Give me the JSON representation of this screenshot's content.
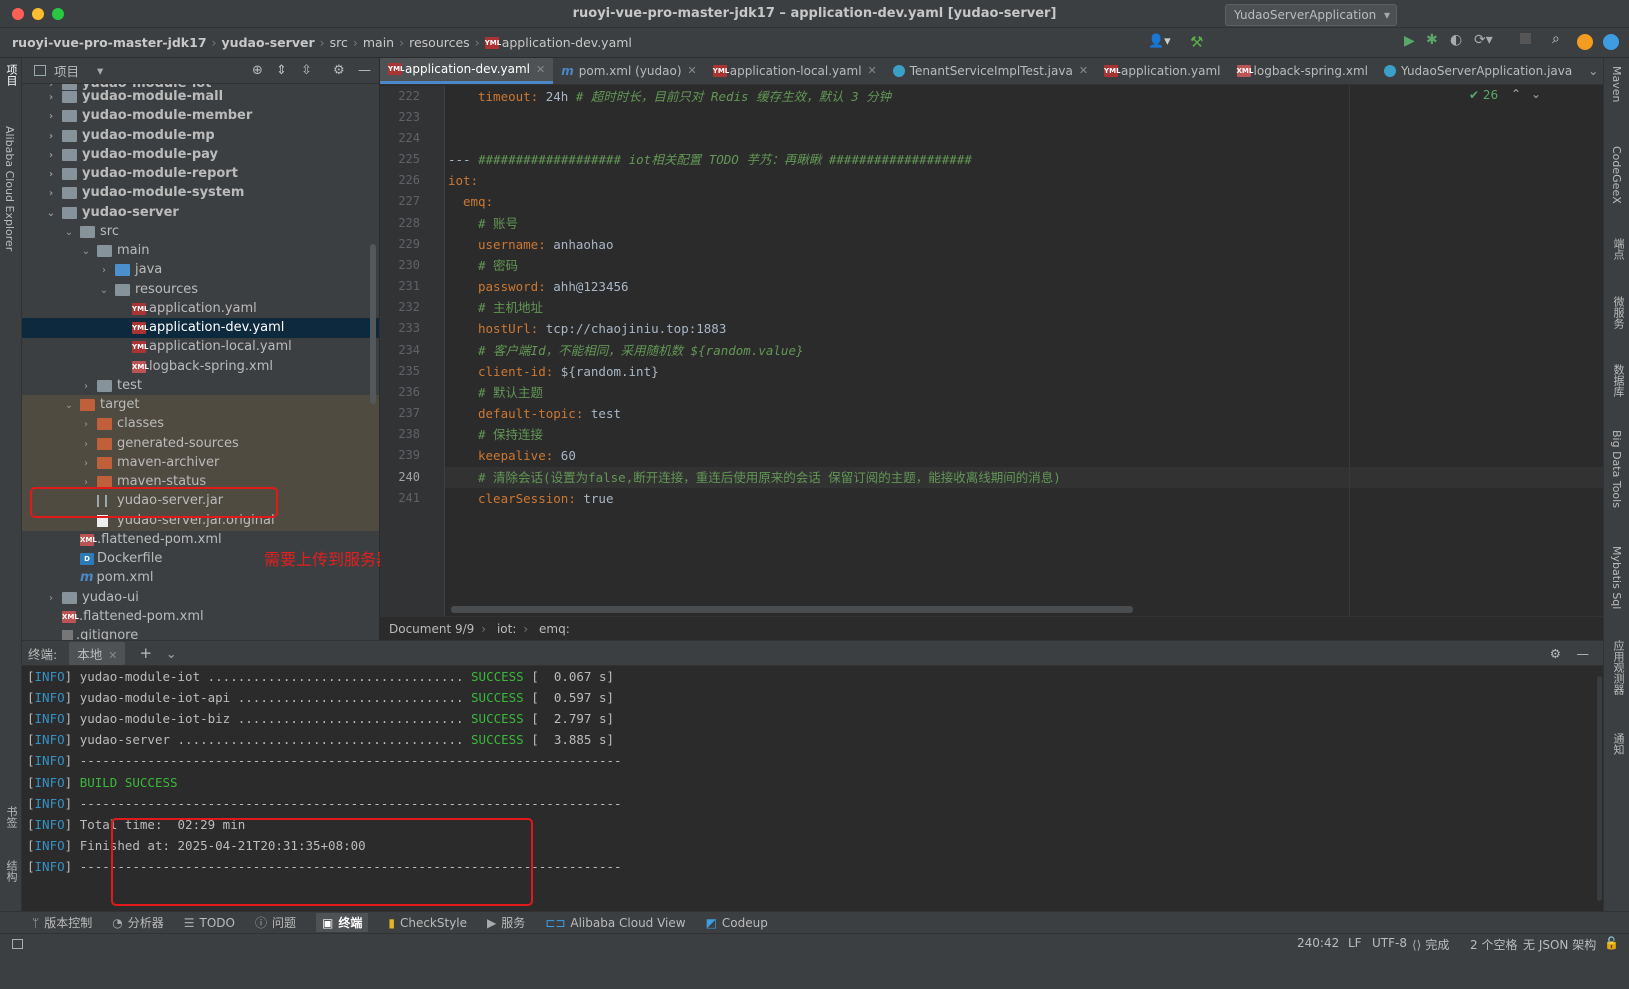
{
  "window": {
    "title": "ruoyi-vue-pro-master-jdk17 – application-dev.yaml [yudao-server]"
  },
  "breadcrumb": [
    "ruoyi-vue-pro-master-jdk17",
    "yudao-server",
    "src",
    "main",
    "resources",
    "application-dev.yaml"
  ],
  "run_config": "YudaoServerApplication",
  "project_panel": {
    "title": "项目"
  },
  "left_strip": {
    "project": "项目",
    "alibaba": "Alibaba Cloud Explorer",
    "bookmarks": "书签",
    "structure": "结构"
  },
  "right_strip": {
    "maven": "Maven",
    "codegeex": "CodeGeeX",
    "endpoints": "端点",
    "microservice": "微服务",
    "database": "数据库",
    "bigdata": "Big Data Tools",
    "mybatis": "Mybatis Sql",
    "appmonitor": "应用观测器",
    "notify": "通知"
  },
  "tree": [
    {
      "label": "yudao-module-iot",
      "bold": true
    },
    {
      "label": "yudao-module-mall",
      "bold": true
    },
    {
      "label": "yudao-module-member",
      "bold": true
    },
    {
      "label": "yudao-module-mp",
      "bold": true
    },
    {
      "label": "yudao-module-pay",
      "bold": true
    },
    {
      "label": "yudao-module-report",
      "bold": true
    },
    {
      "label": "yudao-module-system",
      "bold": true
    },
    {
      "label": "yudao-server",
      "bold": true
    },
    {
      "label": "src"
    },
    {
      "label": "main"
    },
    {
      "label": "java"
    },
    {
      "label": "resources"
    },
    {
      "label": "application.yaml"
    },
    {
      "label": "application-dev.yaml"
    },
    {
      "label": "application-local.yaml"
    },
    {
      "label": "logback-spring.xml"
    },
    {
      "label": "test"
    },
    {
      "label": "target"
    },
    {
      "label": "classes"
    },
    {
      "label": "generated-sources"
    },
    {
      "label": "maven-archiver"
    },
    {
      "label": "maven-status"
    },
    {
      "label": "yudao-server.jar"
    },
    {
      "label": "yudao-server.jar.original"
    },
    {
      "label": ".flattened-pom.xml"
    },
    {
      "label": "Dockerfile"
    },
    {
      "label": "pom.xml"
    },
    {
      "label": "yudao-ui"
    },
    {
      "label": ".flattened-pom.xml"
    },
    {
      "label": ".gitignore"
    }
  ],
  "annotation": "需要上传到服务器",
  "tabs": [
    "application-dev.yaml",
    "pom.xml (yudao)",
    "application-local.yaml",
    "TenantServiceImplTest.java",
    "application.yaml",
    "logback-spring.xml",
    "YudaoServerApplication.java"
  ],
  "inspection_count": "26",
  "code": {
    "line_numbers": [
      "222",
      "223",
      "224",
      "225",
      "226",
      "227",
      "228",
      "229",
      "230",
      "231",
      "232",
      "233",
      "234",
      "235",
      "236",
      "237",
      "238",
      "239",
      "240",
      "241"
    ],
    "l222_key": "timeout",
    "l222_val": " 24h ",
    "l222_comment": "# 超时时长，目前只对 Redis 缓存生效，默认 3 分钟",
    "l225_dash": "--- ",
    "l225_comment": "################### iot相关配置 TODO 芋艿：再瞅瞅 ###################",
    "l226_key": "iot",
    "l227_key": "emq",
    "l228_comment": "# 账号",
    "l229_key": "username",
    "l229_val": " anhaohao",
    "l230_comment": "# 密码",
    "l231_key": "password",
    "l231_val": " ahh@123456",
    "l232_comment": "# 主机地址",
    "l233_key": "hostUrl",
    "l233_val": " tcp://chaojiniu.top:1883",
    "l234_comment": "# 客户端Id，不能相同，采用随机数 ${random.value}",
    "l235_key": "client-id",
    "l235_val": " ${random.int}",
    "l236_comment": "# 默认主题",
    "l237_key": "default-topic",
    "l237_val": " test",
    "l238_comment": "# 保持连接",
    "l239_key": "keepalive",
    "l239_val": " 60",
    "l240_comment": "# 清除会话(设置为false,断开连接，重连后使用原来的会话 保留订阅的主题，能接收离线期间的消息)",
    "l241_key": "clearSession",
    "l241_val": " true"
  },
  "editor_breadcrumb": [
    "Document 9/9",
    "iot:",
    "emq:"
  ],
  "terminal_tabs": {
    "label": "终端:",
    "local": "本地"
  },
  "terminal_lines": [
    {
      "tag": "INFO",
      "text": " yudao-module-iot .................................. ",
      "status": "SUCCESS",
      "tail": " [  0.067 s]"
    },
    {
      "tag": "INFO",
      "text": " yudao-module-iot-api .............................. ",
      "status": "SUCCESS",
      "tail": " [  0.597 s]"
    },
    {
      "tag": "INFO",
      "text": " yudao-module-iot-biz .............................. ",
      "status": "SUCCESS",
      "tail": " [  2.797 s]"
    },
    {
      "tag": "INFO",
      "text": " yudao-server ...................................... ",
      "status": "SUCCESS",
      "tail": " [  3.885 s]"
    },
    {
      "tag": "INFO",
      "text": " ------------------------------------------------------------------------",
      "status": "",
      "tail": ""
    },
    {
      "tag": "INFO",
      "text": " ",
      "status": "BUILD SUCCESS",
      "tail": ""
    },
    {
      "tag": "INFO",
      "text": " ------------------------------------------------------------------------",
      "status": "",
      "tail": ""
    },
    {
      "tag": "INFO",
      "text": " Total time:  02:29 min",
      "status": "",
      "tail": ""
    },
    {
      "tag": "INFO",
      "text": " Finished at: 2025-04-21T20:31:35+08:00",
      "status": "",
      "tail": ""
    },
    {
      "tag": "INFO",
      "text": " ------------------------------------------------------------------------",
      "status": "",
      "tail": ""
    }
  ],
  "bottom_tools": [
    "版本控制",
    "分析器",
    "TODO",
    "问题",
    "终端",
    "CheckStyle",
    "服务",
    "Alibaba Cloud View",
    "Codeup"
  ],
  "status": {
    "position": "240:42",
    "line_sep": "LF",
    "encoding": "UTF-8",
    "vcs": "完成",
    "indent": "2 个空格",
    "schema": "无 JSON 架构"
  },
  "colors": {
    "accent": "#4a88c7",
    "highlight_box": "#e0191b"
  }
}
